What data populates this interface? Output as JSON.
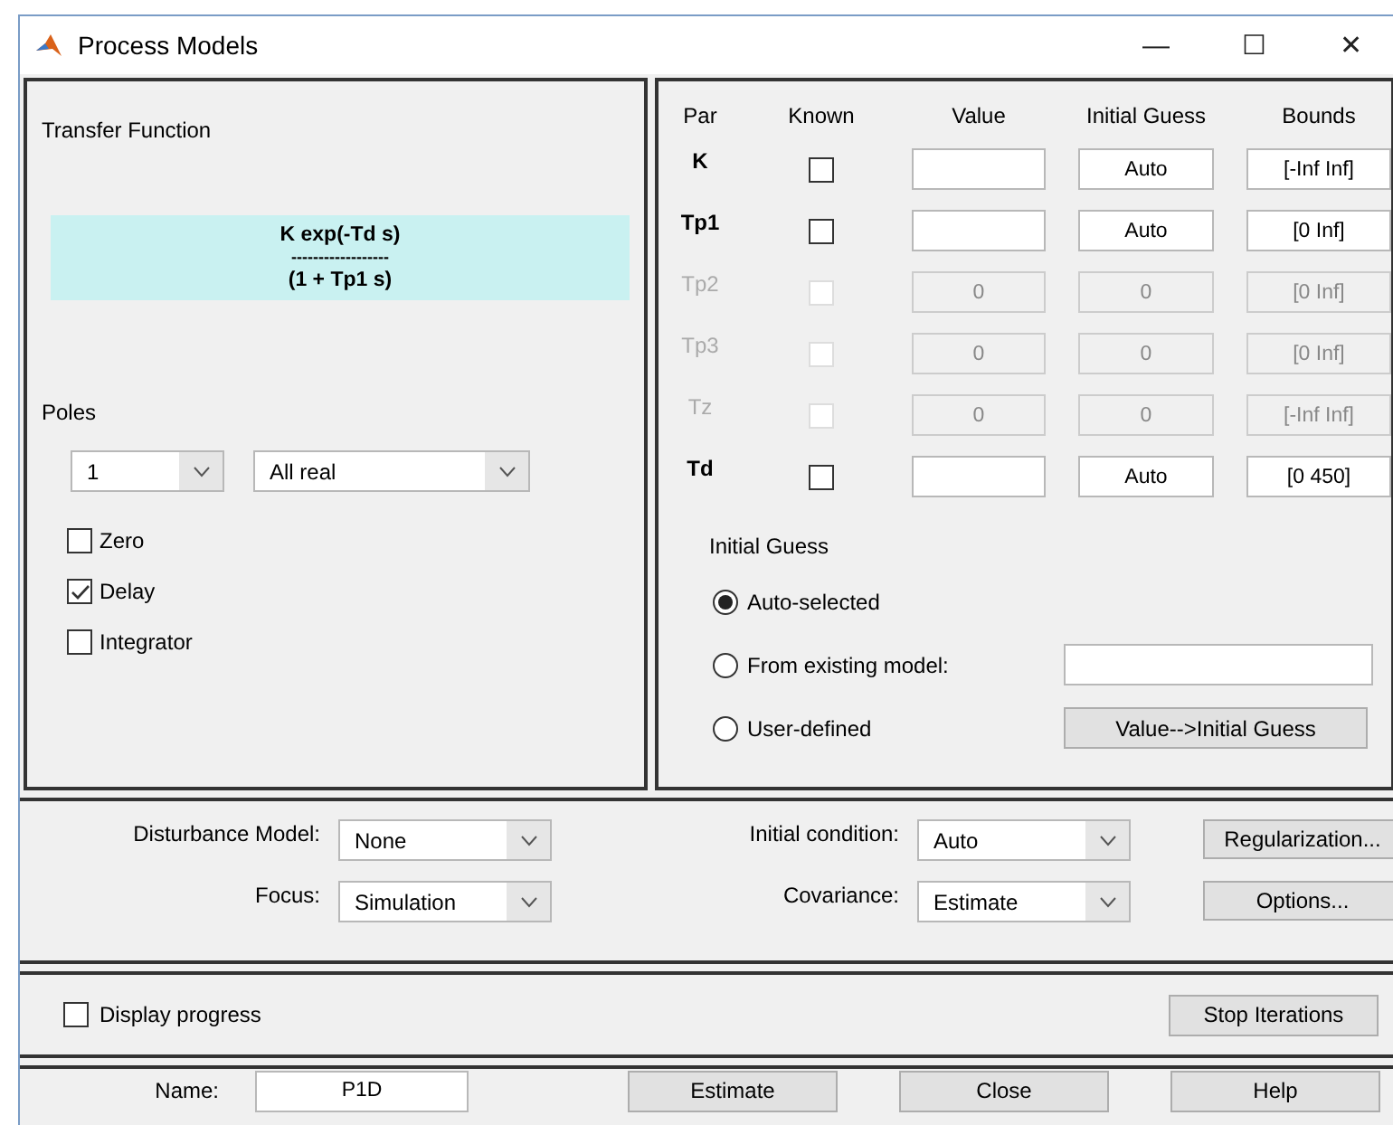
{
  "window": {
    "title": "Process Models",
    "controls": [
      "—",
      "☐",
      "✕"
    ]
  },
  "transfer_function": {
    "label": "Transfer Function",
    "numerator": "K exp(-Td s)",
    "divider": "------------------",
    "denominator": "(1 + Tp1 s)"
  },
  "poles": {
    "label": "Poles",
    "count": "1",
    "type": "All real"
  },
  "options": [
    {
      "label": "Zero",
      "checked": false
    },
    {
      "label": "Delay",
      "checked": true
    },
    {
      "label": "Integrator",
      "checked": false
    }
  ],
  "parameters": {
    "columns": [
      "Par",
      "Known",
      "Value",
      "Initial Guess",
      "Bounds"
    ],
    "rows": [
      {
        "par": "K",
        "known": false,
        "disabled": false,
        "value": "",
        "initial_guess": "Auto",
        "bounds": "[-Inf Inf]"
      },
      {
        "par": "Tp1",
        "known": false,
        "disabled": false,
        "value": "",
        "initial_guess": "Auto",
        "bounds": "[0 Inf]"
      },
      {
        "par": "Tp2",
        "known": false,
        "disabled": true,
        "value": "0",
        "initial_guess": "0",
        "bounds": "[0 Inf]"
      },
      {
        "par": "Tp3",
        "known": false,
        "disabled": true,
        "value": "0",
        "initial_guess": "0",
        "bounds": "[0 Inf]"
      },
      {
        "par": "Tz",
        "known": false,
        "disabled": true,
        "value": "0",
        "initial_guess": "0",
        "bounds": "[-Inf Inf]"
      },
      {
        "par": "Td",
        "known": false,
        "disabled": false,
        "value": "",
        "initial_guess": "Auto",
        "bounds": "[0 450]"
      }
    ]
  },
  "initial_guess": {
    "label": "Initial Guess",
    "choices": [
      {
        "label": "Auto-selected",
        "selected": true
      },
      {
        "label": "From existing model:",
        "selected": false
      },
      {
        "label": "User-defined",
        "selected": false
      }
    ],
    "copy_button": "Value-->Initial Guess"
  },
  "settings": {
    "disturbance_model": {
      "label": "Disturbance Model:",
      "value": "None"
    },
    "focus": {
      "label": "Focus:",
      "value": "Simulation"
    },
    "initial_condition": {
      "label": "Initial condition:",
      "value": "Auto"
    },
    "covariance": {
      "label": "Covariance:",
      "value": "Estimate"
    },
    "buttons": [
      "Regularization...",
      "Options..."
    ]
  },
  "progress": {
    "label": "Display progress",
    "checked": false,
    "stop_button": "Stop Iterations"
  },
  "footer": {
    "name_label": "Name:",
    "name_value": "P1D",
    "buttons": [
      "Estimate",
      "Close",
      "Help"
    ]
  }
}
